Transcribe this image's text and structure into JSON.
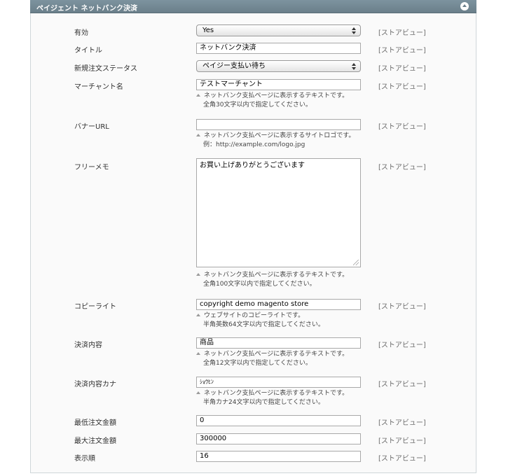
{
  "section": {
    "title": "ペイジェント ネットバンク決済"
  },
  "scope_label": "[ストアビュー]",
  "fields": {
    "enabled": {
      "label": "有効",
      "value": "Yes"
    },
    "title": {
      "label": "タイトル",
      "value": "ネットバンク決済"
    },
    "new_order_status": {
      "label": "新規注文ステータス",
      "value": "ペイジー支払い待ち"
    },
    "merchant_name": {
      "label": "マーチャント名",
      "value": "テストマーチャント",
      "note_line1": "ネットバンク支払ページに表示するテキストです。",
      "note_line2": "全角30文字以内で指定してください。"
    },
    "banner_url": {
      "label": "バナーURL",
      "value": "",
      "note_line1": "ネットバンク支払ページに表示するサイトロゴです。",
      "note_line2": "例：http://example.com/logo.jpg"
    },
    "free_memo": {
      "label": "フリーメモ",
      "value": "お買い上げありがとうございます",
      "note_line1": "ネットバンク支払ページに表示するテキストです。",
      "note_line2": "全角100文字以内で指定してください。"
    },
    "copyright": {
      "label": "コピーライト",
      "value": "copyright demo magento store",
      "note_line1": "ウェブサイトのコピーライトです。",
      "note_line2": "半角英数64文字以内で指定してください。"
    },
    "payment_detail": {
      "label": "決済内容",
      "value": "商品",
      "note_line1": "ネットバンク支払ページに表示するテキストです。",
      "note_line2": "全角12文字以内で指定してください。"
    },
    "payment_detail_kana": {
      "label": "決済内容カナ",
      "value": "ｼｮｳﾋﾝ",
      "note_line1": "ネットバンク支払ページに表示するテキストです。",
      "note_line2": "半角カナ24文字以内で指定してください。"
    },
    "min_order_total": {
      "label": "最低注文金額",
      "value": "0"
    },
    "max_order_total": {
      "label": "最大注文金額",
      "value": "300000"
    },
    "sort_order": {
      "label": "表示順",
      "value": "16"
    }
  }
}
